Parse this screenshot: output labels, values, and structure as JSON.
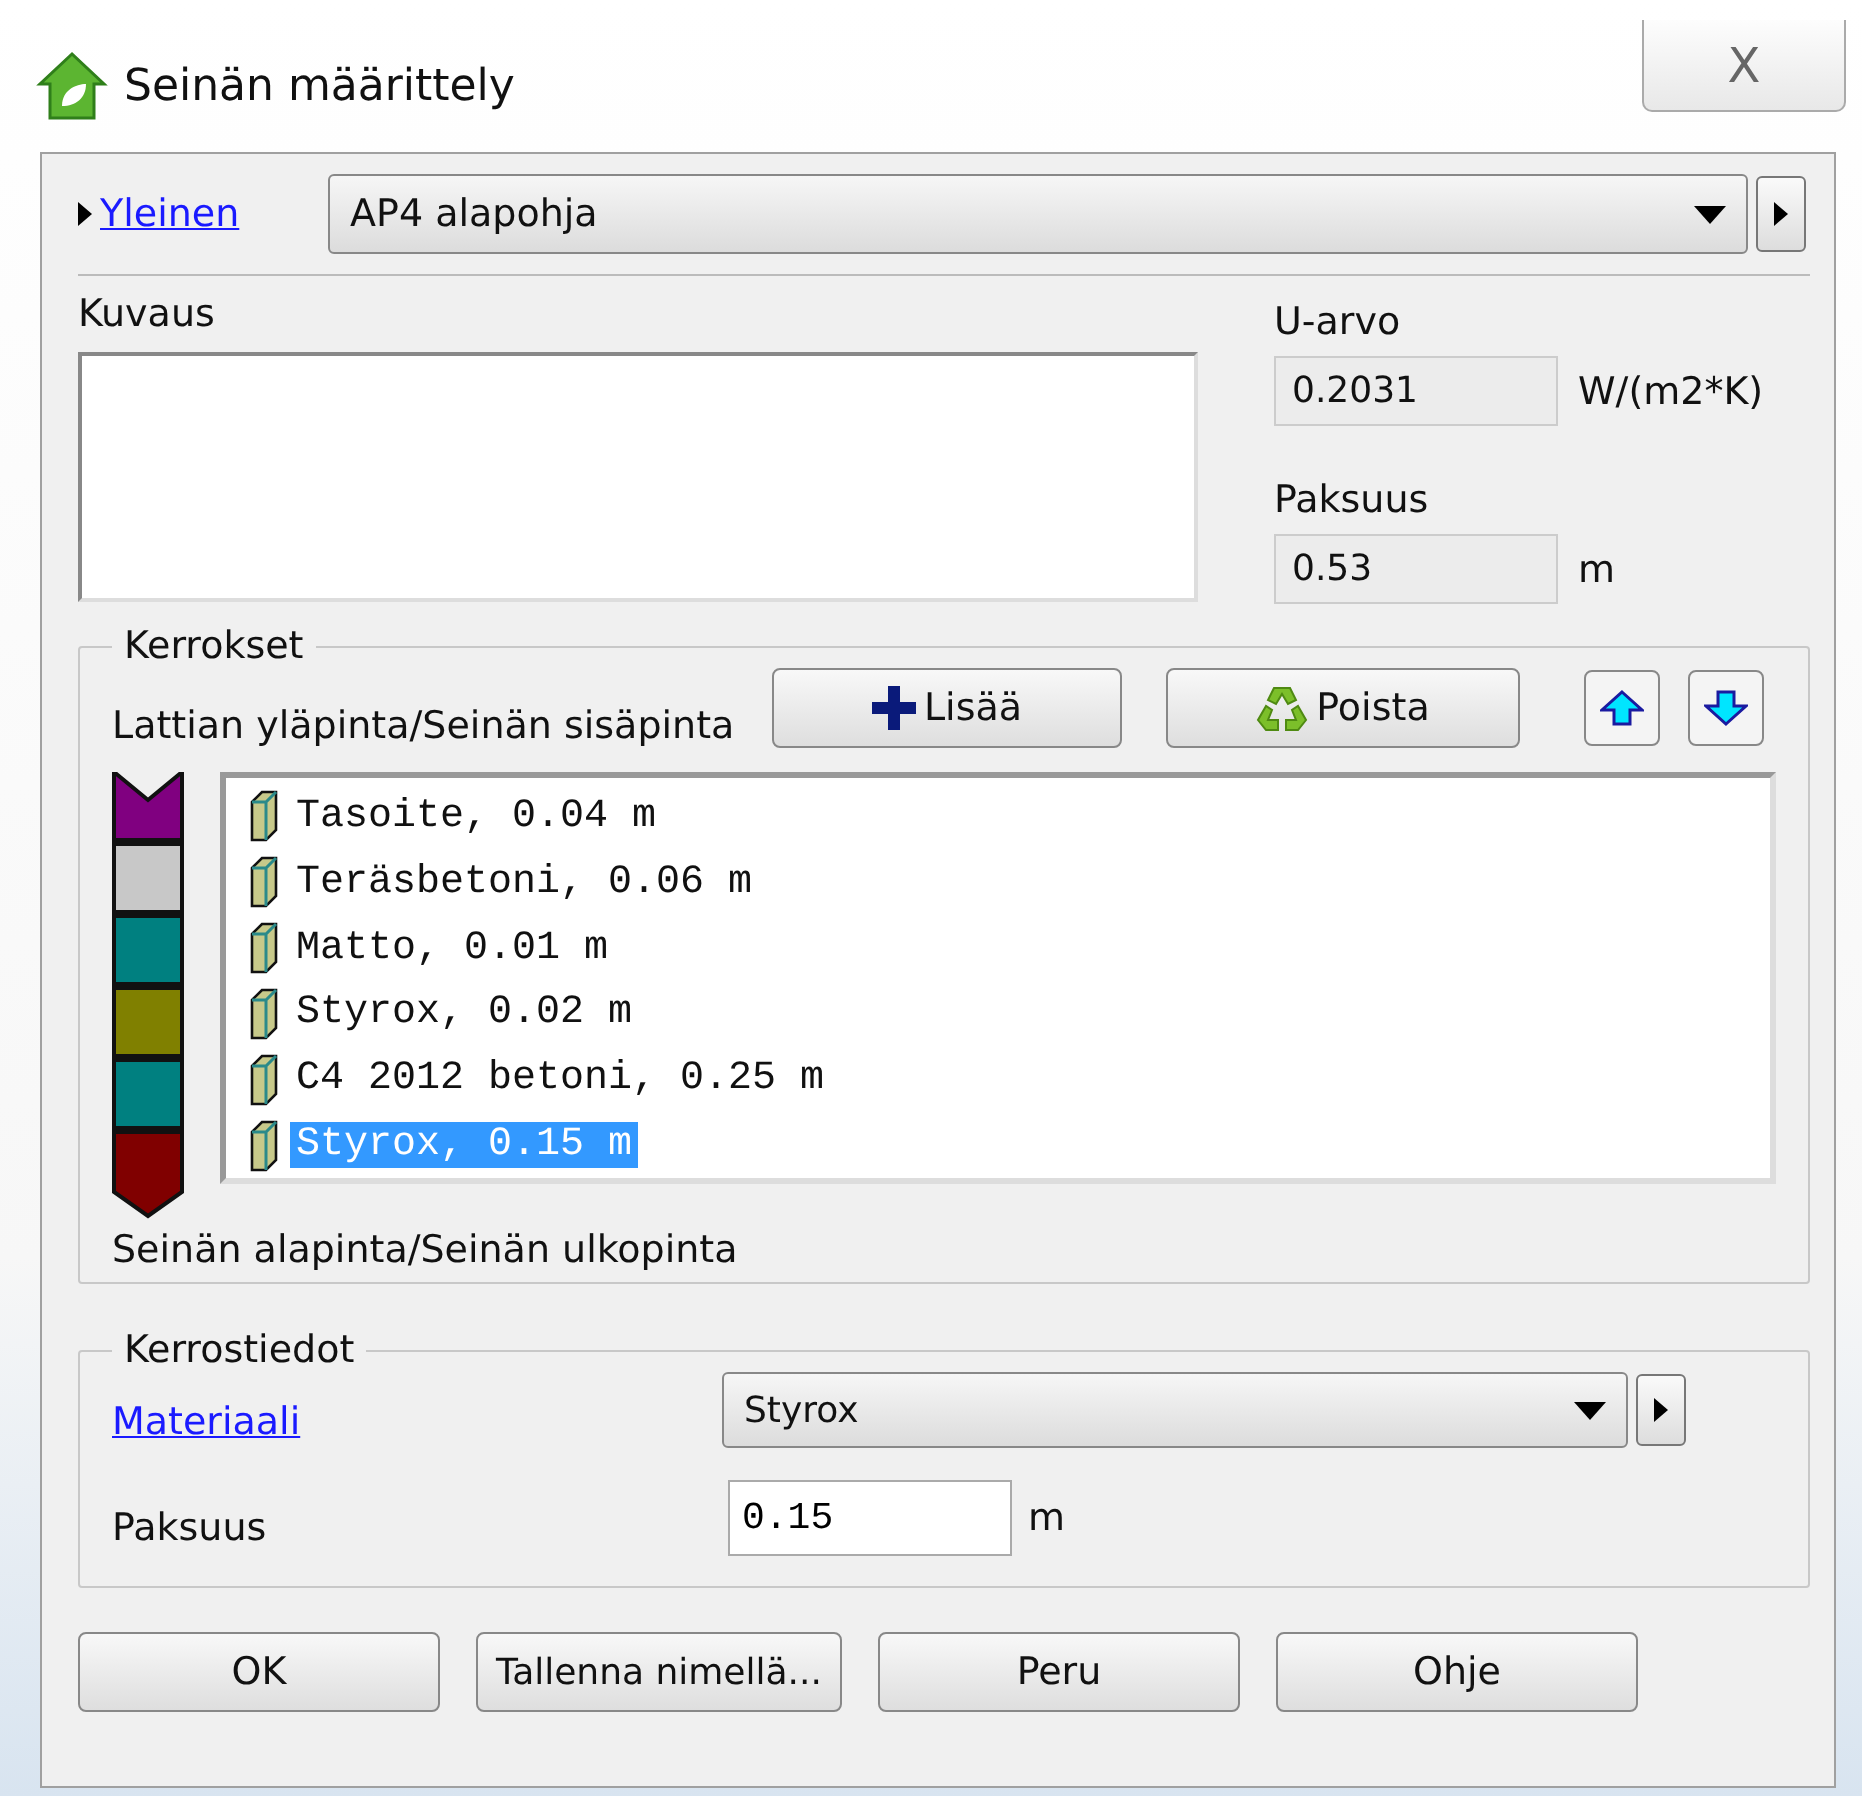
{
  "window": {
    "title": "Seinän määrittely",
    "close": "X"
  },
  "general": {
    "link": "Yleinen",
    "value": "AP4 alapohja"
  },
  "description": {
    "label": "Kuvaus"
  },
  "u_value": {
    "label": "U-arvo",
    "value": "0.2031",
    "unit": "W/(m2*K)"
  },
  "thickness": {
    "label": "Paksuus",
    "value": "0.53",
    "unit": "m"
  },
  "layers": {
    "legend": "Kerrokset",
    "top_label": "Lattian yläpinta/Seinän sisäpinta",
    "bottom_label": "Seinän alapinta/Seinän ulkopinta",
    "add_button": "Lisää",
    "remove_button": "Poista",
    "items": [
      {
        "text": "Tasoite, 0.04 m",
        "color": "#800080",
        "selected": false
      },
      {
        "text": "Teräsbetoni, 0.06 m",
        "color": "#c8c8c8",
        "selected": false
      },
      {
        "text": "Matto, 0.01 m",
        "color": "#008080",
        "selected": false
      },
      {
        "text": "Styrox, 0.02 m",
        "color": "#808000",
        "selected": false
      },
      {
        "text": "C4 2012 betoni, 0.25 m",
        "color": "#008080",
        "selected": false
      },
      {
        "text": "Styrox, 0.15 m",
        "color": "#800000",
        "selected": true
      }
    ]
  },
  "layer_details": {
    "legend": "Kerrostiedot",
    "material_link": "Materiaali",
    "material_value": "Styrox",
    "thickness_label": "Paksuus",
    "thickness_value": "0.15",
    "thickness_unit": "m"
  },
  "buttons": [
    "OK",
    "Tallenna nimellä...",
    "Peru",
    "Ohje"
  ]
}
